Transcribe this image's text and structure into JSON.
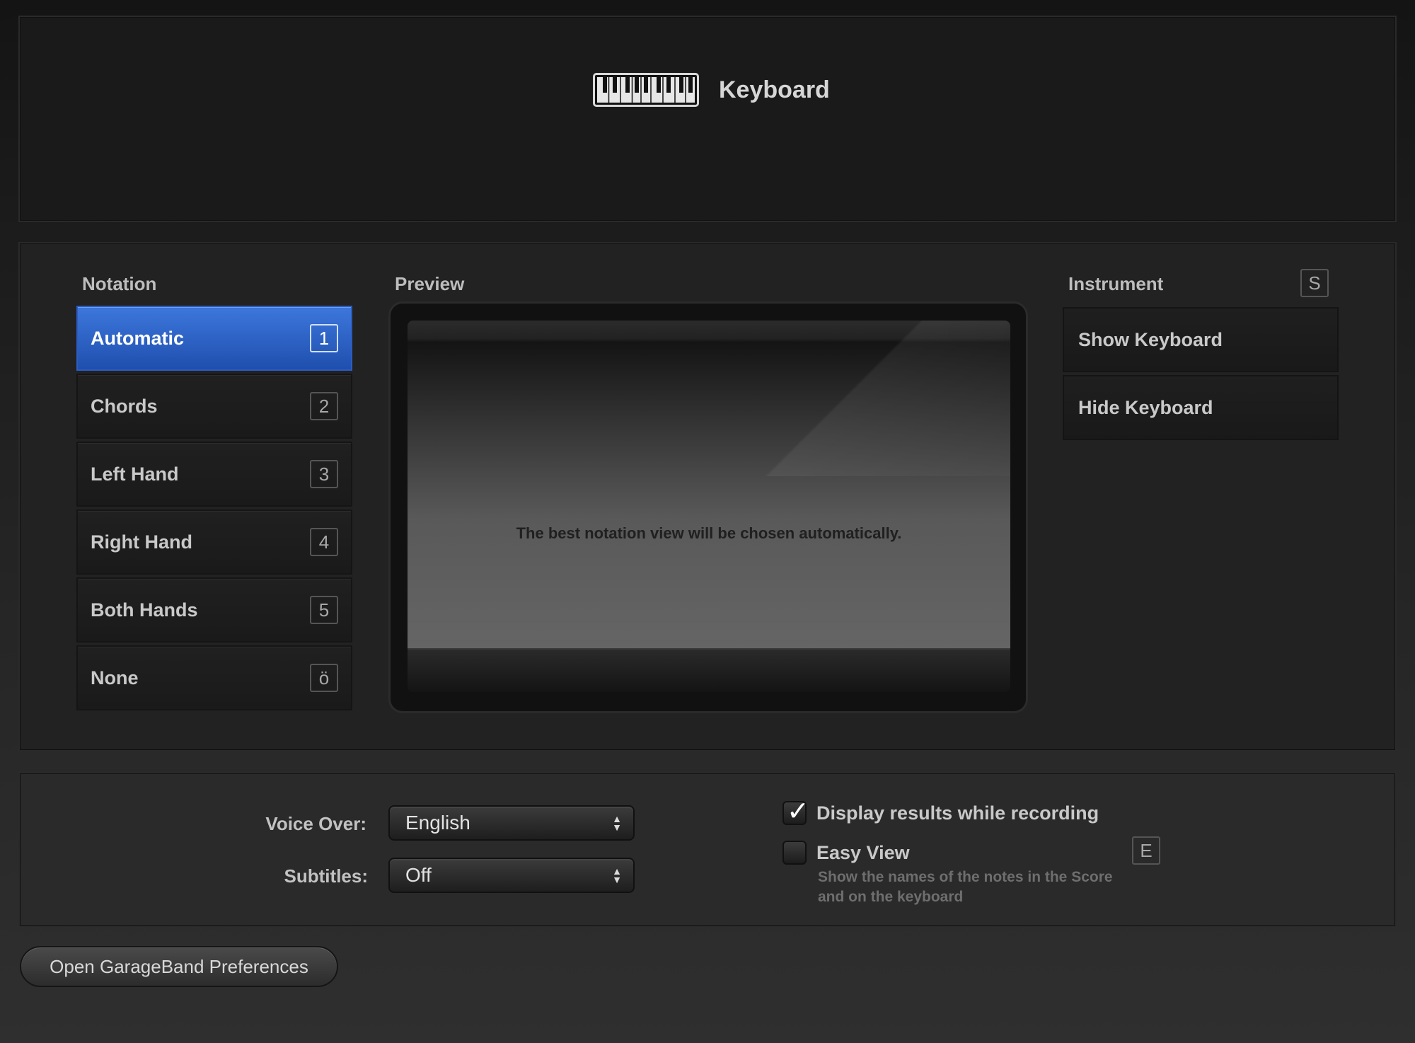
{
  "header": {
    "title": "Keyboard",
    "icon": "keyboard-icon"
  },
  "notation": {
    "label": "Notation",
    "items": [
      {
        "label": "Automatic",
        "key": "1",
        "active": true
      },
      {
        "label": "Chords",
        "key": "2"
      },
      {
        "label": "Left Hand",
        "key": "3"
      },
      {
        "label": "Right Hand",
        "key": "4"
      },
      {
        "label": "Both Hands",
        "key": "5"
      },
      {
        "label": "None",
        "key": "ö"
      }
    ]
  },
  "preview": {
    "label": "Preview",
    "message": "The best notation view will be chosen automatically."
  },
  "instrument": {
    "label": "Instrument",
    "key": "S",
    "items": [
      {
        "label": "Show Keyboard"
      },
      {
        "label": "Hide Keyboard"
      }
    ]
  },
  "settings": {
    "voice_over_label": "Voice Over:",
    "voice_over_value": "English",
    "subtitles_label": "Subtitles:",
    "subtitles_value": "Off",
    "display_results_label": "Display results while recording",
    "display_results_checked": true,
    "easy_view_label": "Easy View",
    "easy_view_checked": false,
    "easy_view_desc": "Show the names of the notes in the Score and on the keyboard",
    "easy_view_key": "E"
  },
  "footer": {
    "prefs_button": "Open GarageBand Preferences"
  },
  "colors": {
    "accent": "#2f63c8",
    "background": "#1b1b1b"
  }
}
